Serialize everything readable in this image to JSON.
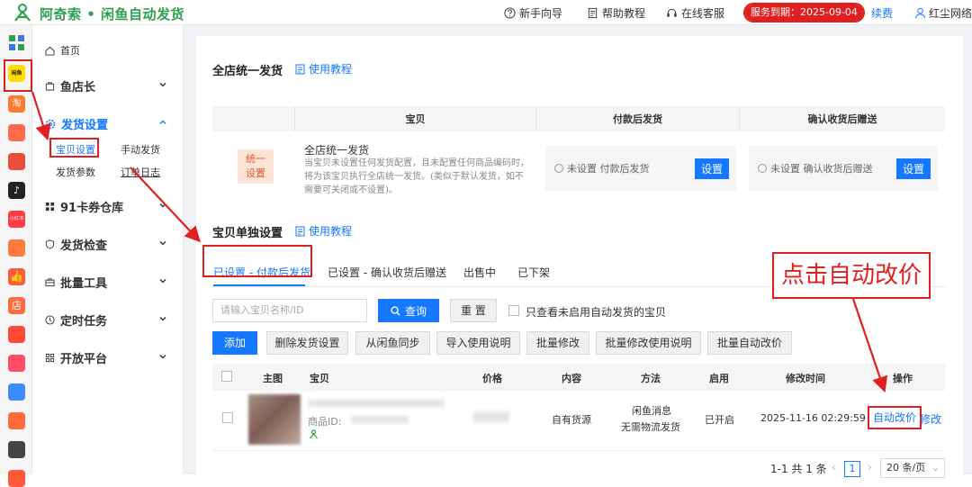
{
  "header": {
    "brand": "阿奇索 • 闲鱼自动发货",
    "nav": [
      "新手向导",
      "帮助教程",
      "在线客服"
    ],
    "expire": "服务到期：2025-09-04",
    "renew": "续费",
    "user": "红尘网络"
  },
  "rail": {
    "labels": [
      "闲鱼",
      "淘",
      "拼多多",
      "抖音",
      "小红书",
      "店"
    ]
  },
  "sidebar": {
    "home": "首页",
    "items": [
      "鱼店长",
      "发货设置",
      "91卡券仓库",
      "发货检查",
      "批量工具",
      "定时任务",
      "开放平台"
    ],
    "sub": [
      "宝贝设置",
      "手动发货",
      "发货参数",
      "订单日志"
    ]
  },
  "store": {
    "title": "全店统一发货",
    "help": "使用教程",
    "cols": [
      "宝贝",
      "付款后发货",
      "确认收货后赠送"
    ],
    "badge": [
      "统一",
      "设置"
    ],
    "desc_title": "全店统一发货",
    "desc": "当宝贝未设置任何发货配置，且未配置任何商品编码时，将为该宝贝执行全店统一发货。(类似于默认发货，如不需要可关闭或不设置)。",
    "pay_status": "未设置 付款后发货",
    "confirm_status": "未设置 确认收货后赠送",
    "set_btn": "设置"
  },
  "single": {
    "title": "宝贝单独设置",
    "help": "使用教程",
    "tabs": [
      "已设置 - 付款后发货",
      "已设置 - 确认收货后赠送",
      "出售中",
      "已下架"
    ],
    "search_placeholder": "请输入宝贝名称/ID",
    "query": "查询",
    "reset": "重 置",
    "only_unenabled": "只查看未启用自动发货的宝贝",
    "buttons": [
      "添加",
      "删除发货设置",
      "从闲鱼同步",
      "导入使用说明",
      "批量修改",
      "批量修改使用说明",
      "批量自动改价"
    ],
    "headers": [
      "主图",
      "宝贝",
      "价格",
      "内容",
      "方法",
      "启用",
      "修改时间",
      "操作"
    ],
    "row": {
      "id_label": "商品ID:",
      "content": "自有货源",
      "method_1": "闲鱼消息",
      "method_2": "无需物流发货",
      "enabled": "已开启",
      "time": "2025-11-16 02:29:59",
      "auto": "自动改价",
      "edit": "修改"
    },
    "pager": {
      "total": "1-1 共 1 条",
      "page": "1",
      "size": "20 条/页"
    }
  },
  "annotation": {
    "callout": "点击自动改价"
  },
  "colors": {
    "brand": "#2e9e4f",
    "primary": "#1677ff",
    "alert": "#e02020"
  }
}
